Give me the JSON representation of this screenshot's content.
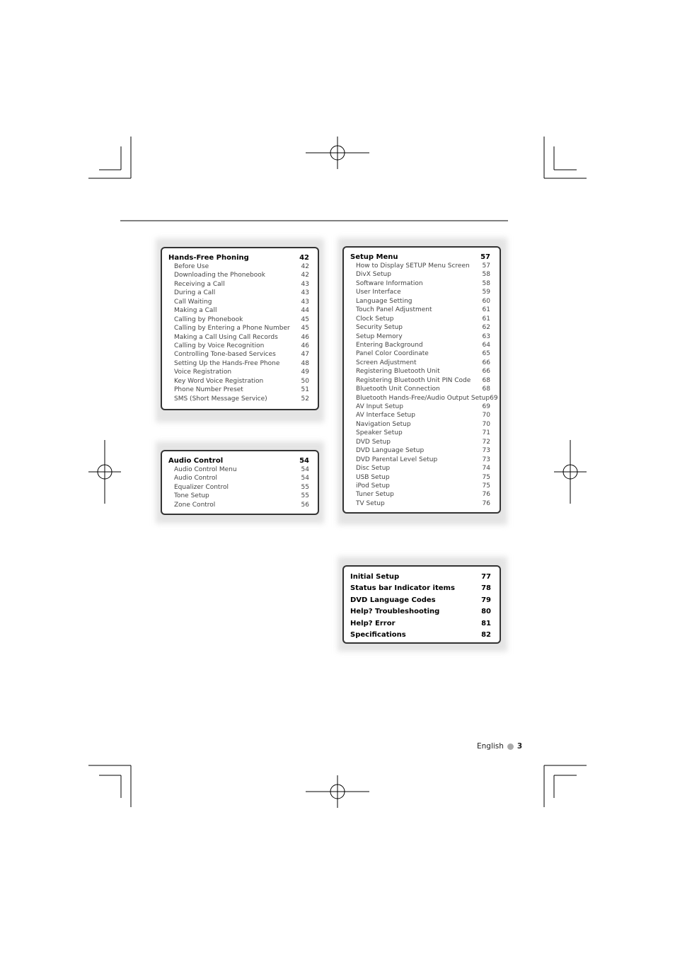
{
  "hands_free": {
    "title": "Hands-Free Phoning",
    "page": "42",
    "items": [
      [
        "Before Use",
        "42"
      ],
      [
        "Downloading the Phonebook",
        "42"
      ],
      [
        "Receiving a Call",
        "43"
      ],
      [
        "During a Call",
        "43"
      ],
      [
        "Call Waiting",
        "43"
      ],
      [
        "Making a Call",
        "44"
      ],
      [
        "Calling by Phonebook",
        "45"
      ],
      [
        "Calling by Entering a Phone Number",
        "45"
      ],
      [
        "Making a Call Using Call Records",
        "46"
      ],
      [
        "Calling by Voice Recognition",
        "46"
      ],
      [
        "Controlling Tone-based Services",
        "47"
      ],
      [
        "Setting Up the Hands-Free Phone",
        "48"
      ],
      [
        "Voice Registration",
        "49"
      ],
      [
        "Key Word Voice Registration",
        "50"
      ],
      [
        "Phone Number Preset",
        "51"
      ],
      [
        "SMS (Short Message Service)",
        "52"
      ]
    ]
  },
  "audio": {
    "title": "Audio Control",
    "page": "54",
    "items": [
      [
        "Audio Control Menu",
        "54"
      ],
      [
        "Audio Control",
        "54"
      ],
      [
        "Equalizer Control",
        "55"
      ],
      [
        "Tone Setup",
        "55"
      ],
      [
        "Zone Control",
        "56"
      ]
    ]
  },
  "setup": {
    "title": "Setup Menu",
    "page": "57",
    "items": [
      [
        "How to Display SETUP Menu Screen",
        "57"
      ],
      [
        "DivX Setup",
        "58"
      ],
      [
        "Software Information",
        "58"
      ],
      [
        "User Interface",
        "59"
      ],
      [
        "Language Setting",
        "60"
      ],
      [
        "Touch Panel Adjustment",
        "61"
      ],
      [
        "Clock Setup",
        "61"
      ],
      [
        "Security Setup",
        "62"
      ],
      [
        "Setup Memory",
        "63"
      ],
      [
        "Entering Background",
        "64"
      ],
      [
        "Panel Color Coordinate",
        "65"
      ],
      [
        "Screen Adjustment",
        "66"
      ],
      [
        "Registering Bluetooth Unit",
        "66"
      ],
      [
        "Registering Bluetooth Unit PIN Code",
        "68"
      ],
      [
        "Bluetooth Unit Connection",
        "68"
      ],
      [
        "Bluetooth Hands-Free/Audio Output Setup",
        "69"
      ],
      [
        "AV Input Setup",
        "69"
      ],
      [
        "AV Interface Setup",
        "70"
      ],
      [
        "Navigation Setup",
        "70"
      ],
      [
        "Speaker Setup",
        "71"
      ],
      [
        "DVD Setup",
        "72"
      ],
      [
        "DVD Language Setup",
        "73"
      ],
      [
        "DVD Parental Level Setup",
        "73"
      ],
      [
        "Disc Setup",
        "74"
      ],
      [
        "USB Setup",
        "75"
      ],
      [
        "iPod Setup",
        "75"
      ],
      [
        "Tuner Setup",
        "76"
      ],
      [
        "TV Setup",
        "76"
      ]
    ]
  },
  "other": [
    [
      "Initial Setup",
      "77"
    ],
    [
      "Status bar Indicator items",
      "78"
    ],
    [
      "DVD Language Codes",
      "79"
    ],
    [
      "Help? Troubleshooting",
      "80"
    ],
    [
      "Help? Error",
      "81"
    ],
    [
      "Specifications",
      "82"
    ]
  ],
  "footer": {
    "language": "English",
    "page": "3"
  }
}
